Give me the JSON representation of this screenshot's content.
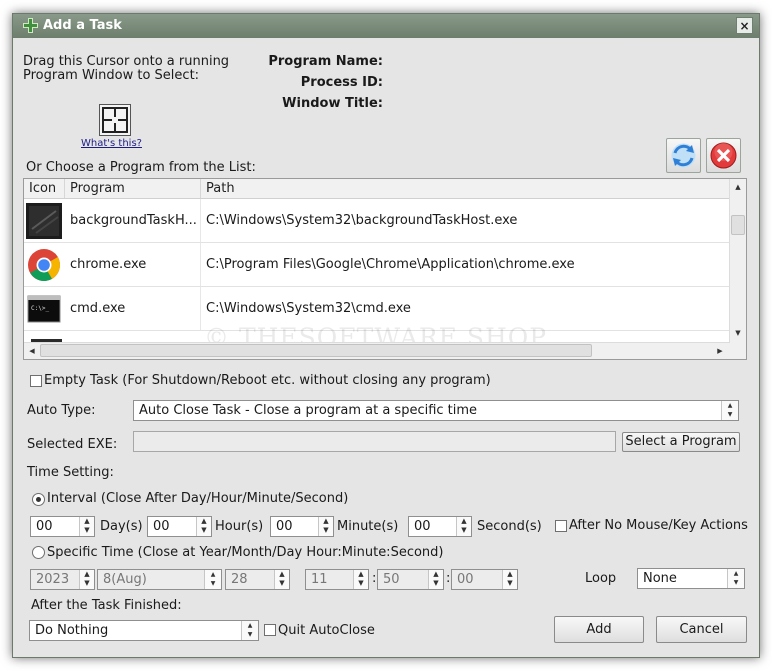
{
  "window": {
    "title": "Add a Task",
    "close_glyph": "×"
  },
  "drag": {
    "instruction_line1": "Drag this Cursor onto a running",
    "instruction_line2": "Program Window to Select:",
    "whats_this": "What's this?"
  },
  "info": {
    "program_name_label": "Program Name:",
    "process_id_label": "Process ID:",
    "window_title_label": "Window Title:"
  },
  "list": {
    "heading": "Or Choose a Program from the List:",
    "columns": [
      "Icon",
      "Program",
      "Path"
    ],
    "rows": [
      {
        "icon": "background-task-icon",
        "program": "backgroundTaskH...",
        "path": "C:\\Windows\\System32\\backgroundTaskHost.exe"
      },
      {
        "icon": "chrome-icon",
        "program": "chrome.exe",
        "path": "C:\\Program Files\\Google\\Chrome\\Application\\chrome.exe"
      },
      {
        "icon": "cmd-icon",
        "program": "cmd.exe",
        "path": "C:\\Windows\\System32\\cmd.exe"
      }
    ],
    "watermark": "© THESOFTWARE.SHOP"
  },
  "empty_task_label": "Empty Task (For Shutdown/Reboot etc. without closing any program)",
  "auto_type": {
    "label": "Auto Type:",
    "value": "Auto Close Task - Close a program at a specific time"
  },
  "selected_exe": {
    "label": "Selected EXE:",
    "value": "",
    "button": "Select a Program"
  },
  "time_setting": {
    "label": "Time Setting:",
    "interval_label": "Interval (Close After Day/Hour/Minute/Second)",
    "day": "00",
    "day_unit": "Day(s)",
    "hour": "00",
    "hour_unit": "Hour(s)",
    "minute": "00",
    "minute_unit": "Minute(s)",
    "second": "00",
    "second_unit": "Second(s)",
    "after_no_input": "After No Mouse/Key Actions",
    "specific_label": "Specific Time (Close at Year/Month/Day Hour:Minute:Second)",
    "year": "2023",
    "month": "8(Aug)",
    "dayofmonth": "28",
    "hh": "11",
    "mm": "50",
    "ss": "00",
    "colon": ":",
    "loop_label": "Loop",
    "loop_value": "None"
  },
  "after": {
    "label": "After the Task Finished:",
    "value": "Do Nothing",
    "quit_label": "Quit AutoClose"
  },
  "buttons": {
    "add": "Add",
    "cancel": "Cancel"
  },
  "colors": {
    "titlebar": "#7a8b7a",
    "dialog_bg": "#e5e5e5",
    "close_red": "#e33b3b",
    "refresh_blue": "#2f7fd6"
  }
}
